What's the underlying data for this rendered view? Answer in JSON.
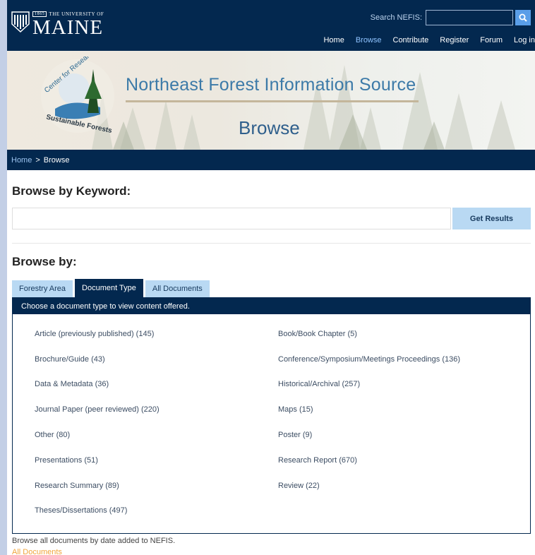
{
  "header": {
    "logo": {
      "year": "1865",
      "university": "THE UNIVERSITY OF",
      "name": "MAINE"
    },
    "search": {
      "label": "Search NEFIS:",
      "value": "",
      "placeholder": ""
    },
    "nav": [
      {
        "label": "Home"
      },
      {
        "label": "Browse"
      },
      {
        "label": "Contribute"
      },
      {
        "label": "Register"
      },
      {
        "label": "Forum"
      },
      {
        "label": "Log in"
      }
    ]
  },
  "banner": {
    "seal_top": "Center for Research on",
    "seal_bottom": "Sustainable Forests",
    "title": "Northeast Forest Information Source",
    "page_title": "Browse"
  },
  "breadcrumb": {
    "home": "Home",
    "separator": ">",
    "current": "Browse"
  },
  "keyword": {
    "heading": "Browse by Keyword:",
    "input_value": "",
    "button": "Get Results"
  },
  "browse": {
    "heading": "Browse by:",
    "tabs": [
      {
        "label": "Forestry Area"
      },
      {
        "label": "Document Type"
      },
      {
        "label": "All Documents"
      }
    ],
    "panel_head": "Choose a document type to view content offered.",
    "items": [
      "Article (previously published) (145)",
      "Book/Book Chapter (5)",
      "Brochure/Guide (43)",
      "Conference/Symposium/Meetings Proceedings (136)",
      "Data & Metadata (36)",
      "Historical/Archival (257)",
      "Journal Paper (peer reviewed) (220)",
      "Maps (15)",
      "Other (80)",
      "Poster (9)",
      "Presentations (51)",
      "Research Report (670)",
      "Research Summary (89)",
      "Review (22)",
      "Theses/Dissertations (497)"
    ]
  },
  "footer": {
    "note": "Browse all documents by date added to NEFIS.",
    "link": "All Documents"
  },
  "colors": {
    "navy": "#03284f",
    "tab_light": "#b9d9f3",
    "search_button": "#5a9ee8",
    "link_orange": "#f0a43a",
    "banner_title": "#3c7aa8"
  }
}
